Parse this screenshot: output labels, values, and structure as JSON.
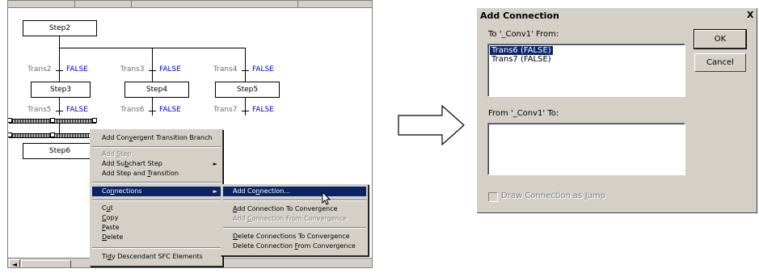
{
  "editor": {
    "steps": [
      "Step2",
      "Step3",
      "Step4",
      "Step5",
      "Step6"
    ],
    "transitions": [
      {
        "name": "Trans2",
        "value": "FALSE"
      },
      {
        "name": "Trans3",
        "value": "FALSE"
      },
      {
        "name": "Trans4",
        "value": "FALSE"
      },
      {
        "name": "Trans5",
        "value": "FALSE"
      },
      {
        "name": "Trans6",
        "value": "FALSE"
      },
      {
        "name": "Trans7",
        "value": "FALSE"
      }
    ],
    "scroll_left_glyph": "◄"
  },
  "context_menu": {
    "items": [
      {
        "label": "Add Convergent Transition Branch",
        "disabled": false
      },
      {
        "label": "Add Step",
        "disabled": true
      },
      {
        "label": "Add Subchart Step",
        "disabled": false,
        "submenu": true
      },
      {
        "label": "Add Step and Transition",
        "disabled": false
      },
      {
        "label": "Connections",
        "disabled": false,
        "submenu": true,
        "highlighted": true
      },
      {
        "label": "Cut",
        "disabled": false
      },
      {
        "label": "Copy",
        "disabled": false
      },
      {
        "label": "Paste",
        "disabled": false
      },
      {
        "label": "Delete",
        "disabled": false
      },
      {
        "label": "Tidy Descendant SFC Elements",
        "disabled": false
      }
    ],
    "submenu_arrow": "►"
  },
  "connections_submenu": {
    "items": [
      {
        "label": "Add Connection...",
        "highlighted": true
      },
      {
        "label": "Add Connection To Convergence",
        "disabled": false
      },
      {
        "label": "Add Connection From Convergence",
        "disabled": true
      },
      {
        "label": "Delete Connections To Convergence",
        "disabled": false
      },
      {
        "label": "Delete Connection From Convergence",
        "disabled": false
      }
    ]
  },
  "dialog": {
    "title": "Add Connection",
    "close_glyph": "X",
    "from_label": "To '_Conv1' From:",
    "from_list": [
      "Trans6 (FALSE)",
      "Trans7 (FALSE)"
    ],
    "selected_index": 0,
    "to_label": "From '_Conv1' To:",
    "to_list": [],
    "ok_label": "OK",
    "cancel_label": "Cancel",
    "checkbox_label": "Draw Connection as Jump",
    "checkbox_checked": false,
    "checkbox_enabled": false
  },
  "colors": {
    "false_text": "#0000c8",
    "menu_highlight": "#0a246a",
    "window_face": "#d4d0c8"
  }
}
